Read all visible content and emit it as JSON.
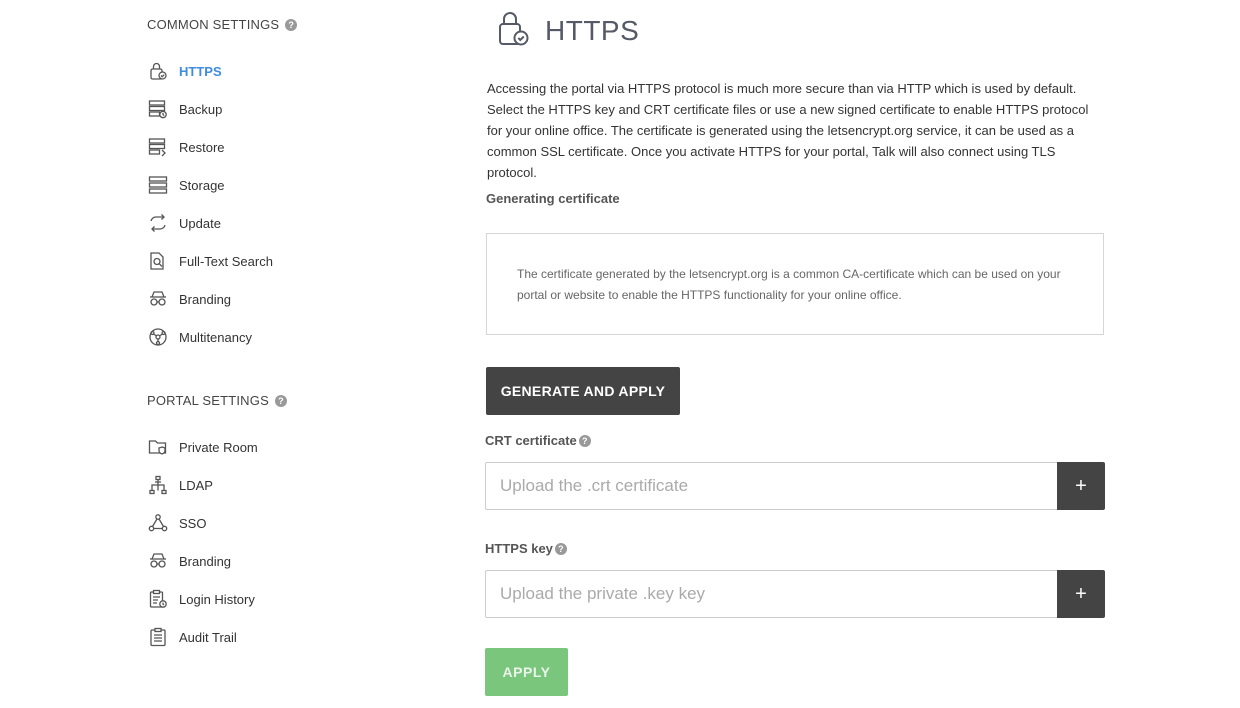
{
  "sidebar": {
    "common_heading": "COMMON SETTINGS",
    "common_items": [
      {
        "label": "HTTPS",
        "icon": "lock-shield-icon",
        "active": true
      },
      {
        "label": "Backup",
        "icon": "server-backup-icon"
      },
      {
        "label": "Restore",
        "icon": "server-restore-icon"
      },
      {
        "label": "Storage",
        "icon": "storage-icon"
      },
      {
        "label": "Update",
        "icon": "update-arrows-icon"
      },
      {
        "label": "Full-Text Search",
        "icon": "document-search-icon"
      },
      {
        "label": "Branding",
        "icon": "branding-mask-icon"
      },
      {
        "label": "Multitenancy",
        "icon": "globe-network-icon"
      }
    ],
    "portal_heading": "PORTAL SETTINGS",
    "portal_items": [
      {
        "label": "Private Room",
        "icon": "folder-shield-icon"
      },
      {
        "label": "LDAP",
        "icon": "ldap-tree-icon"
      },
      {
        "label": "SSO",
        "icon": "sso-nodes-icon"
      },
      {
        "label": "Branding",
        "icon": "branding-mask-icon"
      },
      {
        "label": "Login History",
        "icon": "clipboard-history-icon"
      },
      {
        "label": "Audit Trail",
        "icon": "clipboard-list-icon"
      }
    ]
  },
  "main": {
    "title": "HTTPS",
    "description": "Accessing the portal via HTTPS protocol is much more secure than via HTTP which is used by default. Select the HTTPS key and CRT certificate files or use a new signed certificate to enable HTTPS protocol for your online office. The certificate is generated using the letsencrypt.org service, it can be used as a common SSL certificate. Once you activate HTTPS for your portal, Talk will also connect using TLS protocol.",
    "generating_heading": "Generating certificate",
    "info_text": "The certificate generated by the letsencrypt.org is a common CA-certificate which can be used on your portal or website to enable the HTTPS functionality for your online office.",
    "generate_button": "GENERATE AND APPLY",
    "crt_label": "CRT certificate",
    "crt_placeholder": "Upload the .crt certificate",
    "key_label": "HTTPS key",
    "key_placeholder": "Upload the private .key key",
    "plus": "+",
    "apply_button": "APPLY"
  },
  "help_glyph": "?",
  "colors": {
    "accent": "#3d8ce0",
    "dark_button": "#444444",
    "apply_button": "#6cc070"
  }
}
